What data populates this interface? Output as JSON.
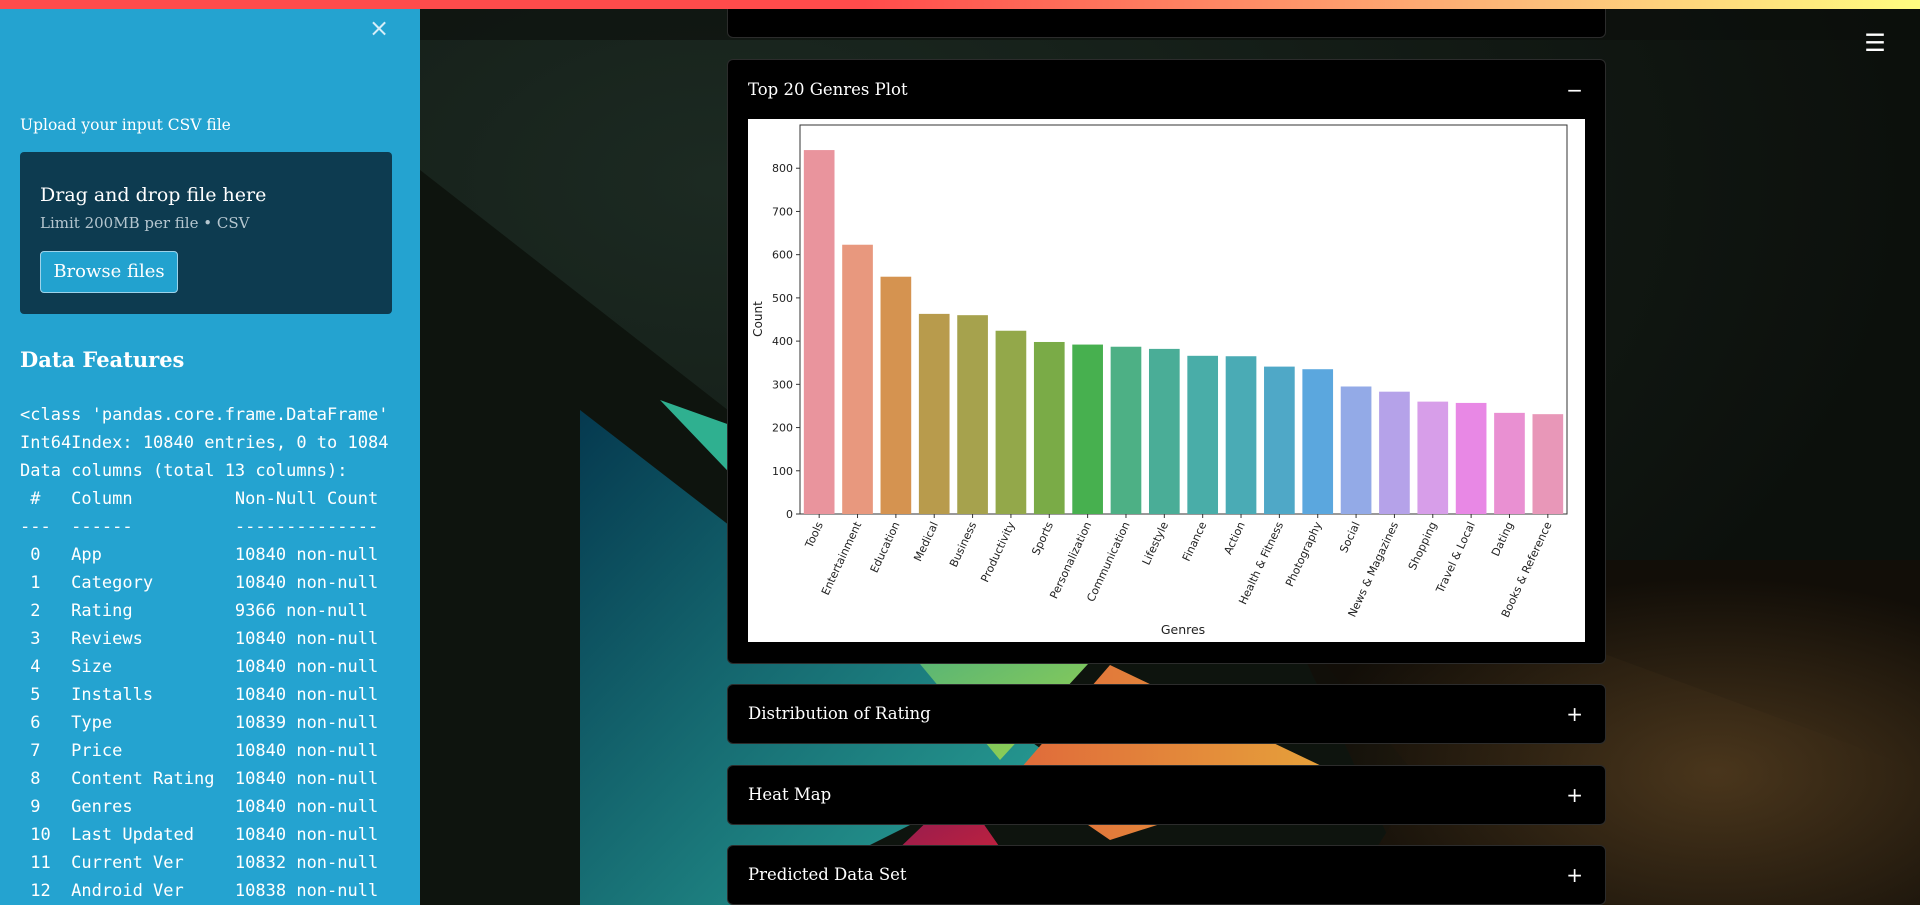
{
  "sidebar": {
    "close_icon": "×",
    "upload_label": "Upload your input CSV file",
    "dropzone_title": "Drag and drop file here",
    "dropzone_subtitle": "Limit 200MB per file • CSV",
    "browse_button": "Browse files",
    "data_features_title": "Data Features",
    "info_lines": [
      "<class 'pandas.core.frame.DataFrame'",
      "Int64Index: 10840 entries, 0 to 1084",
      "Data columns (total 13 columns):",
      " #   Column          Non-Null Count",
      "---  ------          --------------",
      " 0   App             10840 non-null",
      " 1   Category        10840 non-null",
      " 2   Rating          9366 non-null",
      " 3   Reviews         10840 non-null",
      " 4   Size            10840 non-null",
      " 5   Installs        10840 non-null",
      " 6   Type            10839 non-null",
      " 7   Price           10840 non-null",
      " 8   Content Rating  10840 non-null",
      " 9   Genres          10840 non-null",
      " 10  Last Updated    10840 non-null",
      " 11  Current Ver     10832 non-null",
      " 12  Android Ver     10838 non-null"
    ]
  },
  "main": {
    "hamburger_icon": "☰",
    "sections": [
      {
        "title": "Top 20 Genres Plot",
        "toggle": "−"
      },
      {
        "title": "Distribution of Rating",
        "toggle": "+"
      },
      {
        "title": "Heat Map",
        "toggle": "+"
      },
      {
        "title": "Predicted Data Set",
        "toggle": "+"
      }
    ]
  },
  "chart_data": {
    "type": "bar",
    "title": "",
    "xlabel": "Genres",
    "ylabel": "Count",
    "ylim": [
      0,
      900
    ],
    "yticks": [
      0,
      100,
      200,
      300,
      400,
      500,
      600,
      700,
      800
    ],
    "grid": false,
    "categories": [
      "Tools",
      "Entertainment",
      "Education",
      "Medical",
      "Business",
      "Productivity",
      "Sports",
      "Personalization",
      "Communication",
      "Lifestyle",
      "Finance",
      "Action",
      "Health & Fitness",
      "Photography",
      "Social",
      "News & Magazines",
      "Shopping",
      "Travel & Local",
      "Dating",
      "Books & Reference"
    ],
    "values": [
      842,
      623,
      549,
      463,
      460,
      424,
      398,
      392,
      387,
      382,
      366,
      365,
      341,
      335,
      295,
      283,
      260,
      257,
      234,
      231
    ],
    "colors": [
      "#e9949d",
      "#e8987e",
      "#d59350",
      "#b89b4c",
      "#a6a24d",
      "#93a84a",
      "#7aab47",
      "#47b04f",
      "#4db085",
      "#4aad97",
      "#49ada8",
      "#4aabb5",
      "#4fa8c7",
      "#5ba7de",
      "#93aae7",
      "#b5a2e9",
      "#d79ee9",
      "#e888e5",
      "#e990d2",
      "#e897b8"
    ]
  }
}
